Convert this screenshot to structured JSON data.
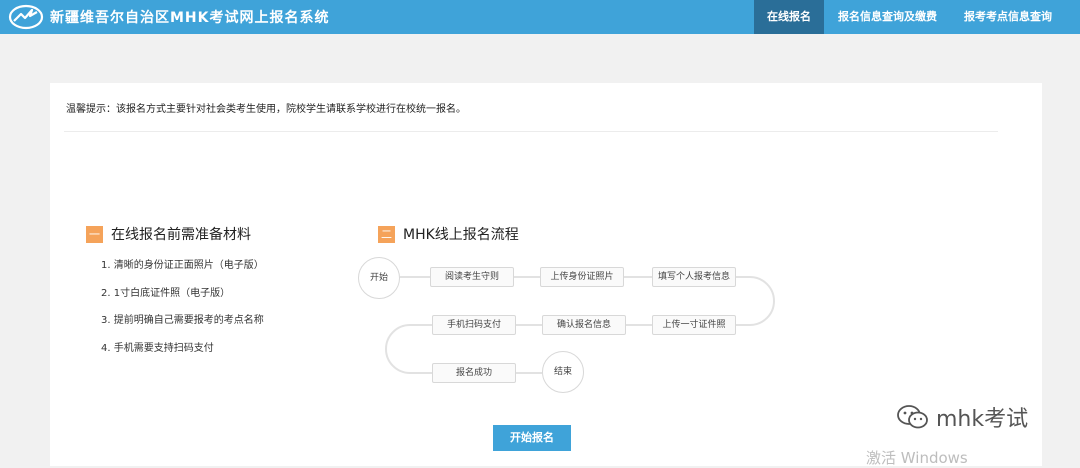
{
  "header": {
    "logo_icon": "brand-logo-icon",
    "title": "新疆维吾尔自治区MHK考试网上报名系统",
    "nav": [
      {
        "label": "在线报名",
        "active": true
      },
      {
        "label": "报名信息查询及缴费",
        "active": false
      },
      {
        "label": "报考考点信息查询",
        "active": false
      }
    ]
  },
  "notice": "温馨提示：该报名方式主要针对社会类考生使用，院校学生请联系学校进行在校统一报名。",
  "materials": {
    "badge": "一",
    "title": "在线报名前需准备材料",
    "items": [
      "1. 清晰的身份证正面照片（电子版）",
      "2. 1寸白底证件照（电子版）",
      "3. 提前明确自己需要报考的考点名称",
      "4. 手机需要支持扫码支付"
    ]
  },
  "process": {
    "badge": "二",
    "title": "MHK线上报名流程",
    "start": "开始",
    "end": "结束",
    "steps": [
      "阅读考生守则",
      "上传身份证照片",
      "填写个人报考信息",
      "上传一寸证件照",
      "确认报名信息",
      "手机扫码支付",
      "报名成功"
    ]
  },
  "start_button": "开始报名",
  "watermark": {
    "icon": "wechat-icon",
    "text": "mhk考试"
  },
  "os_notice": "激活 Windows",
  "colors": {
    "accent": "#3fa3d9",
    "nav_active": "#2a6e98",
    "badge": "#f5a35a"
  }
}
